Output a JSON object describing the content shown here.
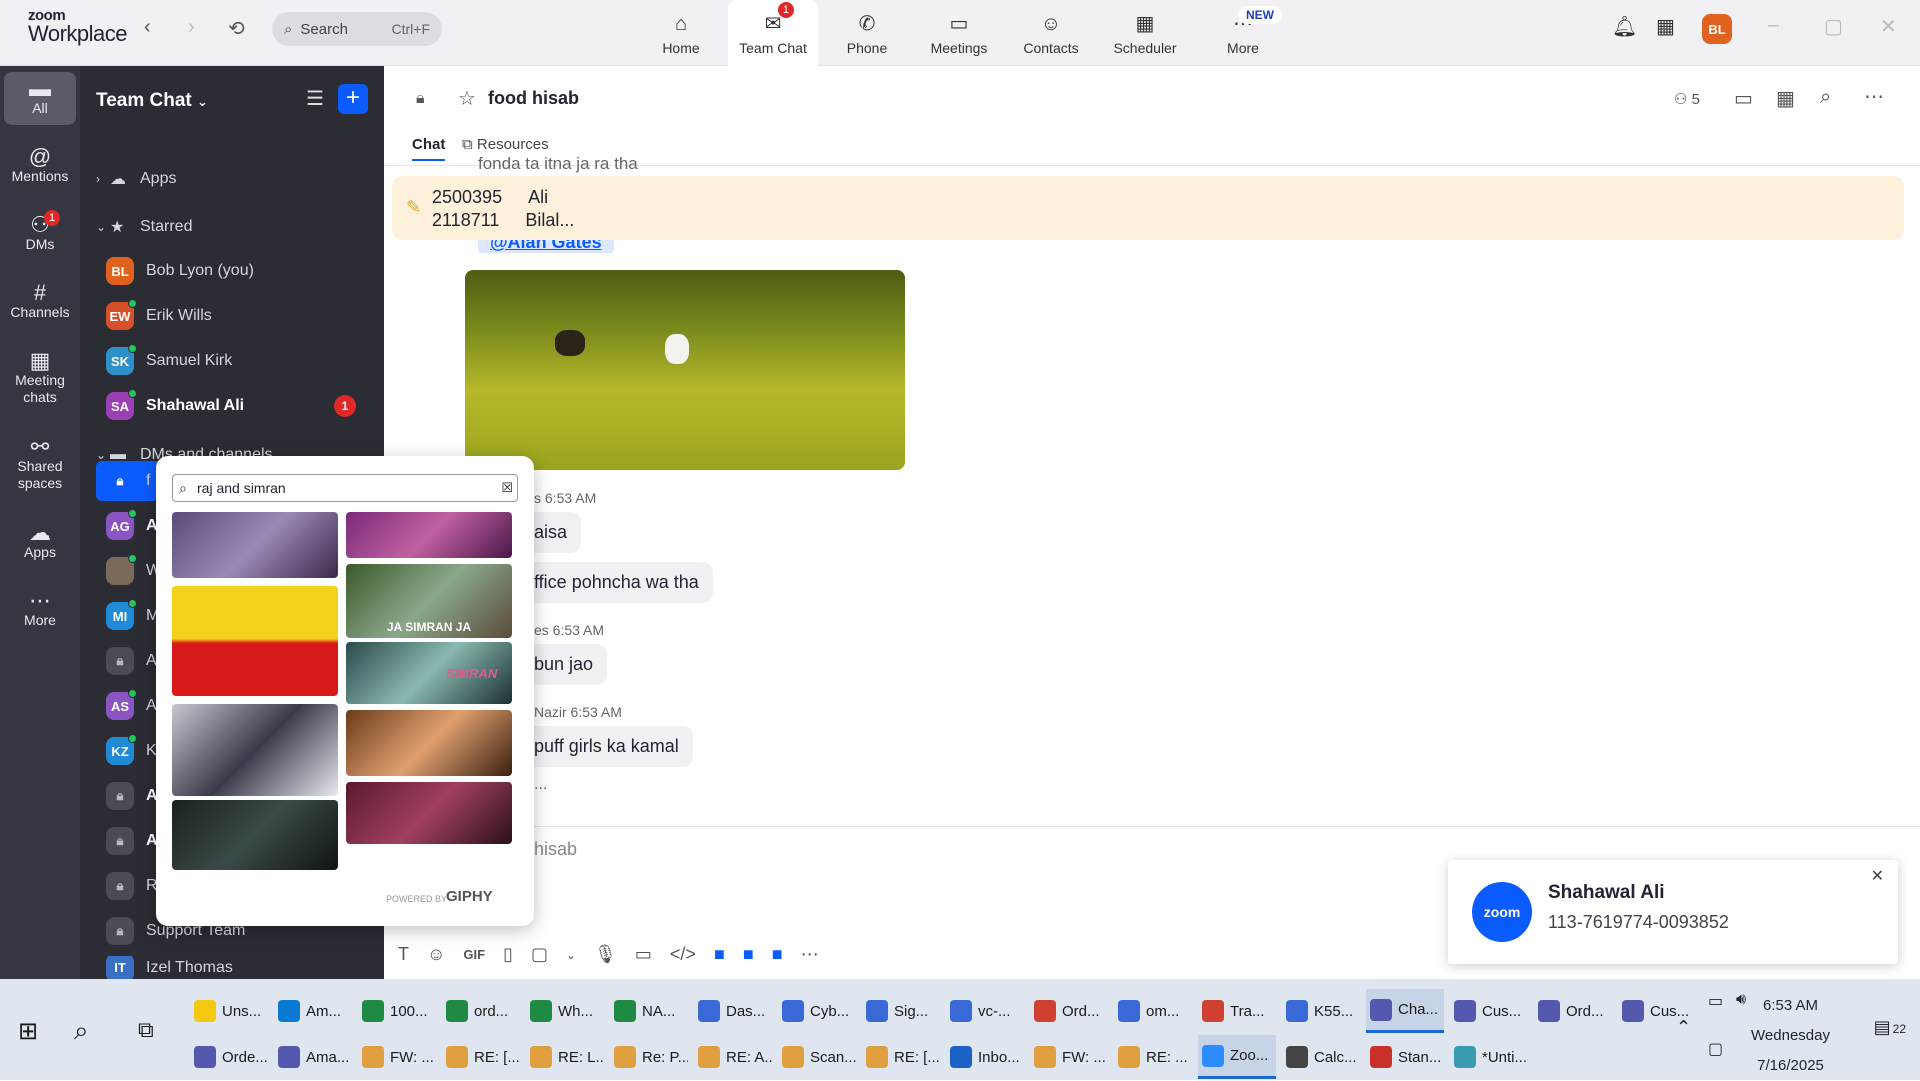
{
  "app": {
    "brand_top": "zoom",
    "brand_bottom": "Workplace"
  },
  "search": {
    "label": "Search",
    "shortcut": "Ctrl+F"
  },
  "top_tabs": [
    {
      "label": "Home",
      "icon": "home-icon"
    },
    {
      "label": "Team Chat",
      "icon": "chat-icon",
      "badge": "1"
    },
    {
      "label": "Phone",
      "icon": "phone-icon"
    },
    {
      "label": "Meetings",
      "icon": "video-icon"
    },
    {
      "label": "Contacts",
      "icon": "contacts-icon"
    },
    {
      "label": "Scheduler",
      "icon": "calendar-icon"
    },
    {
      "label": "More",
      "icon": "more-icon"
    }
  ],
  "more_badge": "NEW",
  "user_avatar": "BL",
  "rail": [
    {
      "label": "All"
    },
    {
      "label": "Mentions"
    },
    {
      "label": "DMs",
      "badge": "1"
    },
    {
      "label": "Channels"
    },
    {
      "label": "Meeting chats"
    },
    {
      "label": "Shared spaces"
    },
    {
      "label": "Apps"
    },
    {
      "label": "More"
    }
  ],
  "sidebar": {
    "title": "Team Chat",
    "apps_label": "Apps",
    "starred_label": "Starred",
    "starred": [
      {
        "initials": "BL",
        "name": "Bob Lyon (you)",
        "color": "#e0621e"
      },
      {
        "initials": "EW",
        "name": "Erik Wills",
        "color": "#d6502a"
      },
      {
        "initials": "SK",
        "name": "Samuel Kirk",
        "color": "#2f8fc9"
      },
      {
        "initials": "SA",
        "name": "Shahawal Ali",
        "color": "#9b3fb5",
        "unread": "1"
      }
    ],
    "dms_label": "DMs and channels",
    "channels": [
      {
        "initials": "",
        "name": "f",
        "lock": true
      },
      {
        "initials": "AG",
        "name": "A",
        "color": "#8a55c2"
      },
      {
        "initials": "",
        "name": "W",
        "photo": true
      },
      {
        "initials": "MI",
        "name": "M",
        "color": "#1f8ad6"
      },
      {
        "initials": "",
        "name": "A",
        "lock": true
      },
      {
        "initials": "AS",
        "name": "A",
        "color": "#8a55c2"
      },
      {
        "initials": "KZ",
        "name": "K",
        "color": "#1f8ad6"
      },
      {
        "initials": "",
        "name": "A",
        "lock": true
      },
      {
        "initials": "",
        "name": "A",
        "lock": true
      },
      {
        "initials": "",
        "name": "R",
        "lock": true
      },
      {
        "initials": "",
        "name": "Support Team",
        "lock": true
      },
      {
        "initials": "IT",
        "name": "Izel Thomas",
        "color": "#3b6fc4"
      }
    ]
  },
  "chat": {
    "title": "food hisab",
    "members": "5",
    "tabs": [
      "Chat",
      "Resources"
    ],
    "pinned_lines": [
      {
        "num": "2500395",
        "name": "Ali"
      },
      {
        "num": "2118711",
        "name": "Bilal..."
      }
    ],
    "partial_top": "fonda ta itna ja ra tha",
    "mention": "@Alan Gates",
    "messages": [
      {
        "meta": "s 6:53 AM",
        "text": "aisa"
      },
      {
        "meta": "",
        "text": "ffice pohncha wa tha"
      },
      {
        "meta": "es 6:53 AM",
        "text": "bun jao"
      },
      {
        "meta": "Nazir 6:53 AM",
        "text": "puff girls ka kamal"
      }
    ],
    "typing": "...",
    "compose_placeholder": "hisab"
  },
  "gif_picker": {
    "query": "raj and simran",
    "gif_captions": [
      "JA SIMRAN JA",
      "SIMRAN"
    ],
    "powered": "POWERED BY",
    "brand": "GIPHY"
  },
  "toast": {
    "name": "Shahawal Ali",
    "number": "113-7619774-0093852",
    "logo": "zoom"
  },
  "taskbar": {
    "row1": [
      "Uns...",
      "Am...",
      "100...",
      "ord...",
      "Wh...",
      "NA...",
      "Das...",
      "Cyb...",
      "Sig...",
      "vc-...",
      "Ord...",
      "om...",
      "Tra...",
      "K55...",
      "Cha...",
      "Cus...",
      "Ord...",
      "Cus..."
    ],
    "row2": [
      "Orde...",
      "Ama...",
      "FW: ...",
      "RE: [...",
      "RE: L...",
      "Re: P...",
      "RE: A...",
      "Scan...",
      "RE: [...",
      "Inbo...",
      "FW: ...",
      "RE: ...",
      "Zoo...",
      "Calc...",
      "Stan...",
      "*Unti..."
    ],
    "time": "6:53 AM",
    "day": "Wednesday",
    "date": "7/16/2025",
    "notif_count": "22"
  }
}
